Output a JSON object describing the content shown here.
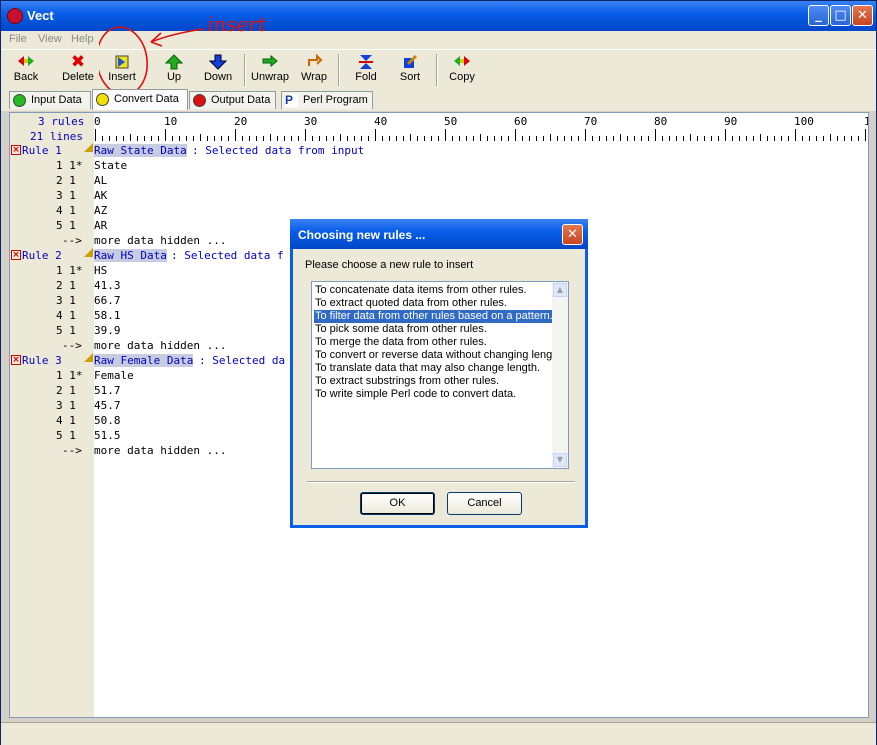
{
  "window": {
    "title": "Vect"
  },
  "menu": [
    "File",
    "View",
    "Help"
  ],
  "toolbar": [
    {
      "label": "Back",
      "icon": "back-icon"
    },
    {
      "label": "Delete",
      "icon": "delete-icon"
    },
    {
      "label": "Insert",
      "icon": "insert-icon"
    },
    {
      "label": "Up",
      "icon": "up-arrow-icon"
    },
    {
      "label": "Down",
      "icon": "down-arrow-icon"
    },
    {
      "label": "Unwrap",
      "icon": "unwrap-icon"
    },
    {
      "label": "Wrap",
      "icon": "wrap-icon"
    },
    {
      "label": "Fold",
      "icon": "fold-icon"
    },
    {
      "label": "Sort",
      "icon": "sort-icon"
    },
    {
      "label": "Copy",
      "icon": "copy-icon"
    }
  ],
  "annotation": {
    "text": "insert"
  },
  "tabs": [
    {
      "label": "Input Data",
      "color": "#22bb22"
    },
    {
      "label": "Convert Data",
      "color": "#f0e000"
    },
    {
      "label": "Output Data",
      "color": "#dd1111"
    },
    {
      "label": "Perl Program",
      "color": "#1a3a9a"
    }
  ],
  "editor": {
    "summary_rules": "3 rules",
    "summary_lines": "21 lines",
    "ruler_labels": [
      "0",
      "10",
      "20",
      "30",
      "40",
      "50",
      "60",
      "70",
      "80",
      "90",
      "100",
      "1"
    ],
    "rules": [
      {
        "label": "Rule 1",
        "name": "Raw State Data",
        "desc": ": Selected data from input",
        "rows": [
          {
            "num": "1 1*",
            "text": "State"
          },
          {
            "num": "2 1",
            "text": "AL"
          },
          {
            "num": "3 1",
            "text": "AK"
          },
          {
            "num": "4 1",
            "text": "AZ"
          },
          {
            "num": "5 1",
            "text": "AR"
          }
        ],
        "hidden_arrow": "-->",
        "hidden_text": "more data hidden ..."
      },
      {
        "label": "Rule 2",
        "name": "Raw HS Data",
        "desc": ": Selected data f",
        "rows": [
          {
            "num": "1 1*",
            "text": "HS"
          },
          {
            "num": "2 1",
            "text": "41.3"
          },
          {
            "num": "3 1",
            "text": "66.7"
          },
          {
            "num": "4 1",
            "text": "58.1"
          },
          {
            "num": "5 1",
            "text": "39.9"
          }
        ],
        "hidden_arrow": "-->",
        "hidden_text": "more data hidden ..."
      },
      {
        "label": "Rule 3",
        "name": "Raw Female Data",
        "desc": ": Selected da",
        "rows": [
          {
            "num": "1 1*",
            "text": "Female"
          },
          {
            "num": "2 1",
            "text": "51.7"
          },
          {
            "num": "3 1",
            "text": "45.7"
          },
          {
            "num": "4 1",
            "text": "50.8"
          },
          {
            "num": "5 1",
            "text": "51.5"
          }
        ],
        "hidden_arrow": "-->",
        "hidden_text": "more data hidden ..."
      }
    ]
  },
  "dialog": {
    "title": "Choosing new rules ...",
    "prompt": "Please choose a new rule to insert",
    "options": [
      "To concatenate data items from other rules.",
      "To extract quoted data from other rules.",
      "To filter data from other rules based on a pattern.",
      "To pick some data from other rules.",
      "To merge the data from other rules.",
      "To convert or reverse data without changing length.",
      "To translate data that may also change length.",
      "To extract substrings from other rules.",
      "To write simple Perl code to convert data."
    ],
    "selected_index": 2,
    "ok_label": "OK",
    "cancel_label": "Cancel"
  }
}
